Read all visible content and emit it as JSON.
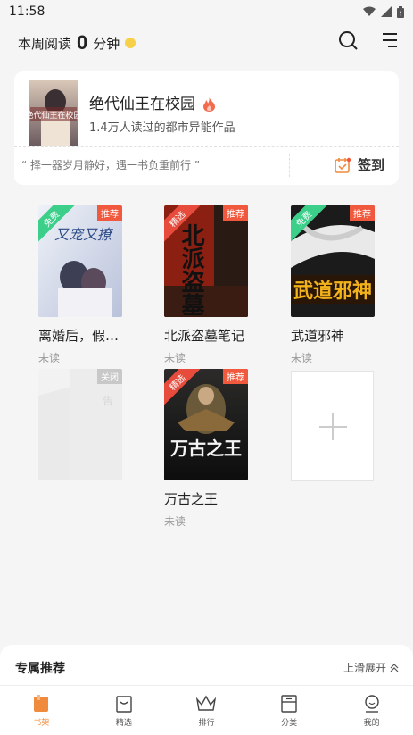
{
  "status_bar": {
    "time": "11:58"
  },
  "header": {
    "reading_label": "本周阅读",
    "reading_count": "0",
    "reading_unit": "分钟"
  },
  "recommend": {
    "cover_text": "绝代仙王在校园",
    "title": "绝代仙王在校园",
    "subtitle": "1.4万人读过的都市异能作品",
    "quote": "“ 择一器岁月静好，遇一书负重前行 ”",
    "signin_label": "签到"
  },
  "shelf": [
    {
      "title": "离婚后，假…",
      "status": "未读",
      "badge": "推荐",
      "ribbon": "免费",
      "cover_text": "又宠又撩"
    },
    {
      "title": "北派盗墓笔记",
      "status": "未读",
      "badge": "推荐",
      "ribbon": "精选",
      "cover_text": "北派盗墓"
    },
    {
      "title": "武道邪神",
      "status": "未读",
      "badge": "推荐",
      "ribbon": "免费",
      "cover_text": "武道邪神"
    },
    {
      "title": "",
      "status": "",
      "badge": "关闭",
      "ribbon": "",
      "cover_text": "告"
    },
    {
      "title": "万古之王",
      "status": "未读",
      "badge": "推荐",
      "ribbon": "精选",
      "cover_text": "万古之王"
    }
  ],
  "bottom_panel": {
    "title": "专属推荐",
    "expand_label": "上滑展开"
  },
  "tabs": [
    {
      "label": "书架",
      "icon": "bookshelf-icon"
    },
    {
      "label": "精选",
      "icon": "featured-icon"
    },
    {
      "label": "排行",
      "icon": "crown-icon"
    },
    {
      "label": "分类",
      "icon": "category-icon"
    },
    {
      "label": "我的",
      "icon": "profile-icon"
    }
  ],
  "colors": {
    "accent": "#f08a3c",
    "badge": "#f0593d",
    "free_ribbon": "#3ccf8a",
    "select_ribbon": "#e74b3c"
  }
}
